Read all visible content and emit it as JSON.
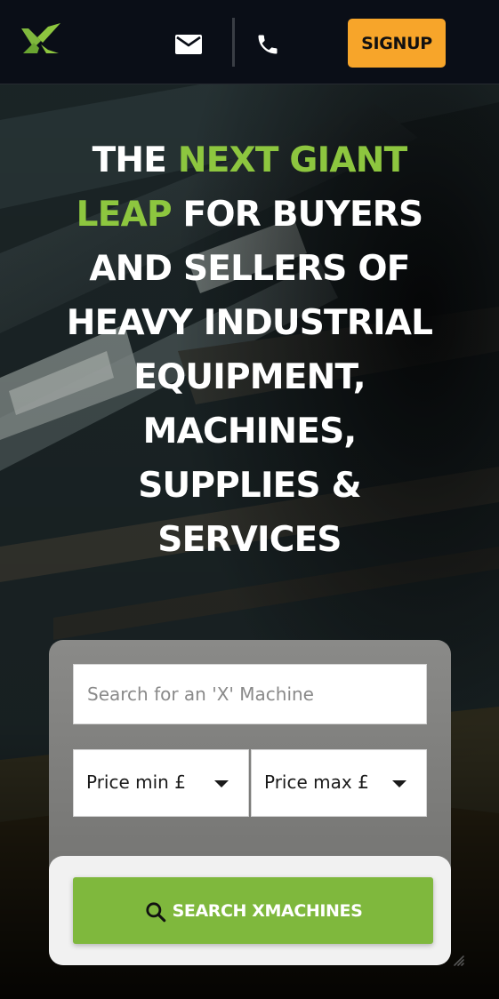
{
  "header": {
    "logo_icon": "x-logo-icon",
    "mail_icon": "mail-icon",
    "phone_icon": "phone-icon",
    "signup_label": "SIGNUP"
  },
  "hero": {
    "headline": {
      "part1": "THE ",
      "accent": "NEXT GIANT LEAP",
      "part2": " FOR BUYERS AND SELLERS OF HEAVY INDUSTRIAL EQUIPMENT, MACHINES, SUPPLIES & SERVICES"
    }
  },
  "search": {
    "placeholder": "Search for an 'X' Machine",
    "value": "",
    "price_min": {
      "label": "Price min £"
    },
    "price_max": {
      "label": "Price max £"
    },
    "button_label": "SEARCH XMACHINES",
    "button_icon": "search-icon"
  },
  "colors": {
    "accent_green": "#8dc63f",
    "button_green": "#7fb83d",
    "signup_orange": "#f7a52a",
    "header_bg": "#0a0e17"
  }
}
